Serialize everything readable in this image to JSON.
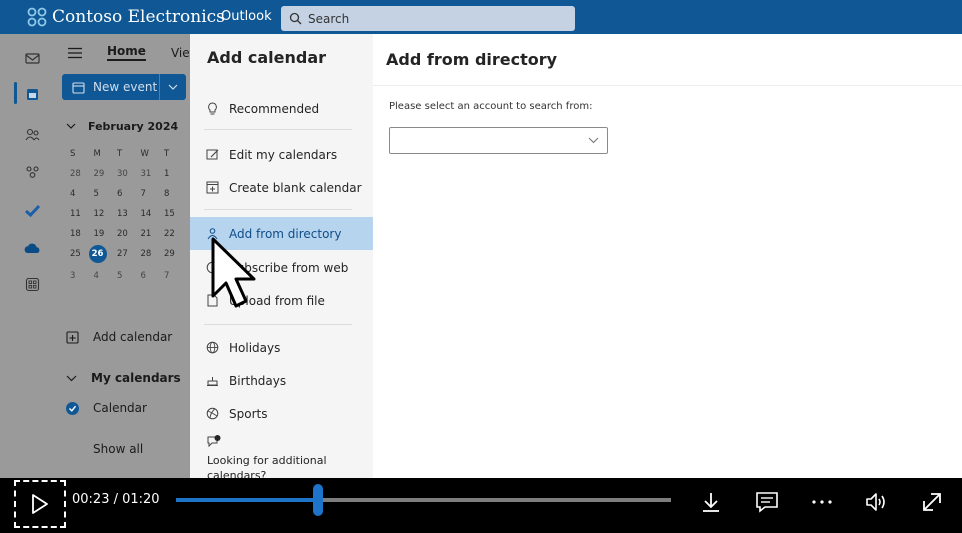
{
  "header": {
    "brand": "Contoso Electronics",
    "app_name": "Outlook",
    "search_placeholder": "Search"
  },
  "calendar_nav": {
    "tabs": [
      "Home",
      "View"
    ],
    "new_event_label": "New event",
    "month_label": "February 2024",
    "weekdays": [
      "S",
      "M",
      "T",
      "W",
      "T"
    ],
    "weeks": [
      [
        "28",
        "29",
        "30",
        "31",
        "1"
      ],
      [
        "4",
        "5",
        "6",
        "7",
        "8"
      ],
      [
        "11",
        "12",
        "13",
        "14",
        "15"
      ],
      [
        "18",
        "19",
        "20",
        "21",
        "22"
      ],
      [
        "25",
        "26",
        "27",
        "28",
        "29"
      ],
      [
        "3",
        "4",
        "5",
        "6",
        "7"
      ]
    ],
    "today": "26",
    "add_calendar_label": "Add calendar",
    "my_calendars_label": "My calendars",
    "calendar_label": "Calendar",
    "show_all_label": "Show all"
  },
  "dialog": {
    "title": "Add calendar",
    "menu": {
      "recommended": "Recommended",
      "edit_my_calendars": "Edit my calendars",
      "create_blank_calendar": "Create blank calendar",
      "add_from_directory": "Add from directory",
      "subscribe_from_web": "Subscribe from web",
      "upload_from_file": "Upload from file",
      "holidays": "Holidays",
      "birthdays": "Birthdays",
      "sports": "Sports"
    },
    "looking_text": "Looking for additional calendars?",
    "right_title": "Add from directory",
    "select_label": "Please select an account to search from:",
    "select_value": ""
  },
  "player": {
    "current_time": "00:23",
    "total_time": "01:20",
    "time_display": "00:23 / 01:20",
    "progress_fraction": 0.2875
  },
  "colors": {
    "brand_blue": "#0f5895",
    "active_menu_bg": "#b7d4ef",
    "progress_blue": "#1e74c8"
  }
}
